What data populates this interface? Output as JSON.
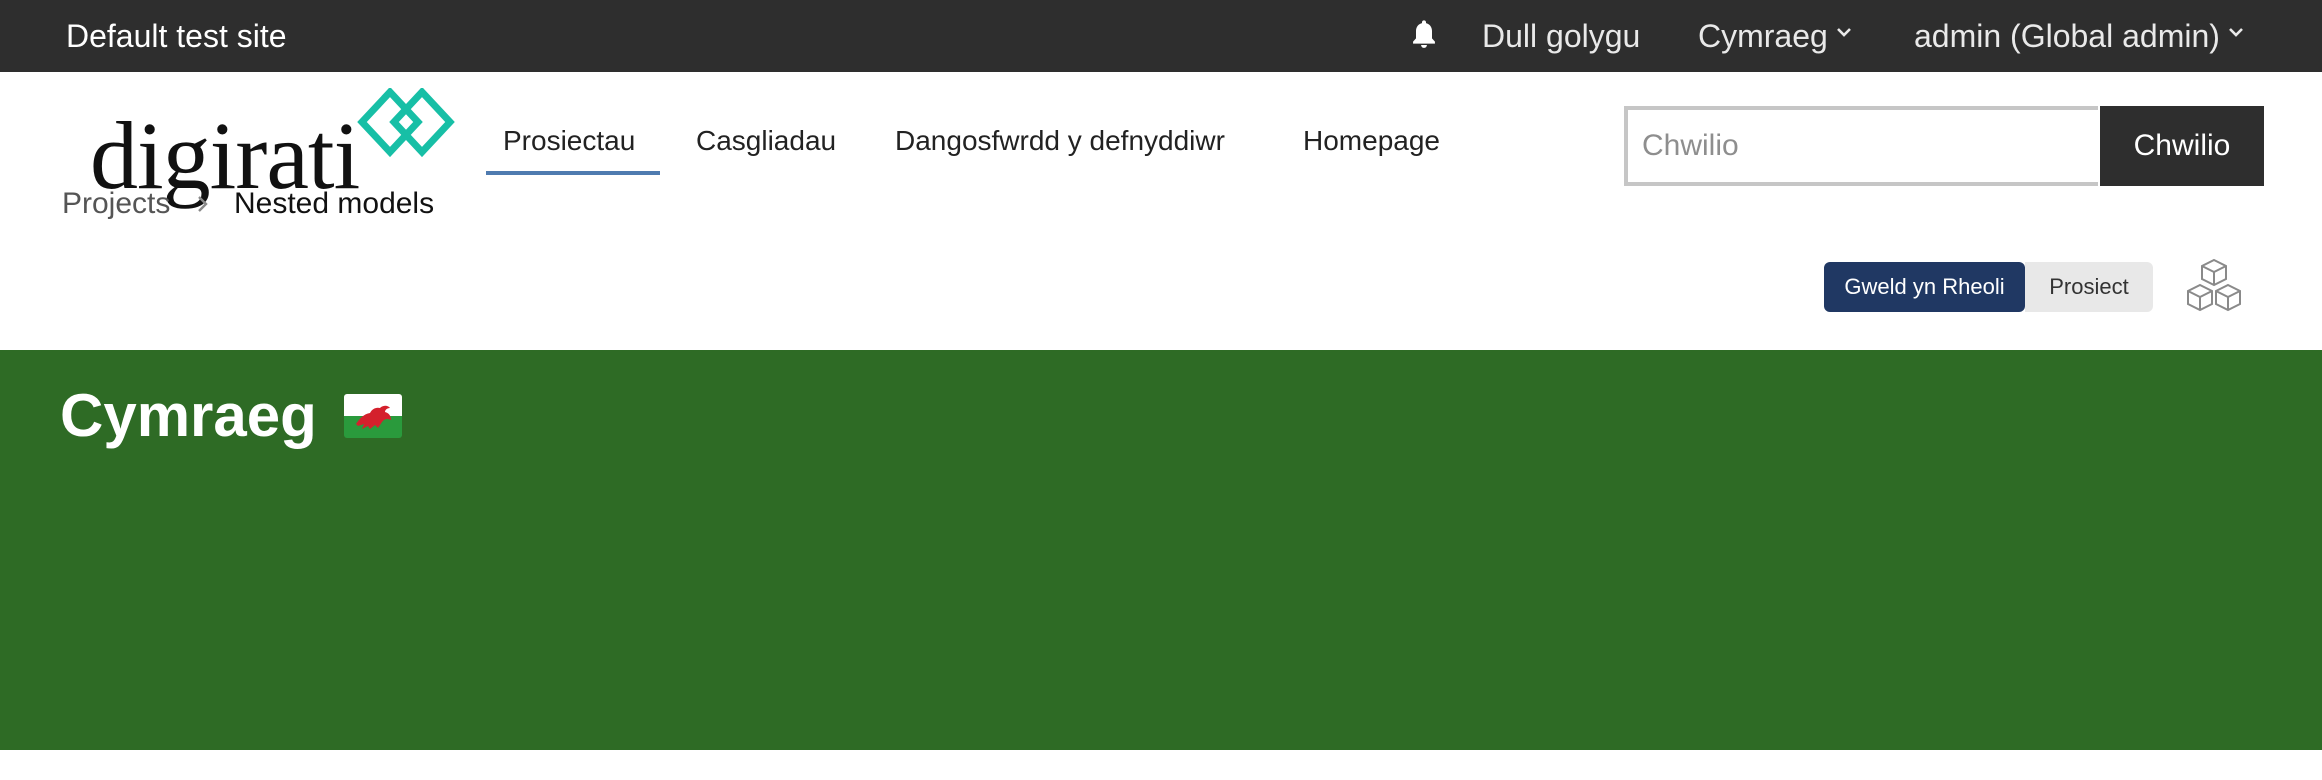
{
  "topbar": {
    "site_name": "Default test site",
    "edit_mode": "Dull golygu",
    "language": "Cymraeg",
    "user": "admin (Global admin)",
    "icons": {
      "notifications": "bell-icon",
      "dropdown": "chevron-down-icon"
    }
  },
  "header": {
    "logo_text": "digirati",
    "nav": [
      "Prosiectau",
      "Casgliadau",
      "Dangosfwrdd y defnyddiwr",
      "Homepage"
    ],
    "active_nav": "Prosiectau",
    "search": {
      "placeholder": "Chwilio",
      "value": "",
      "button": "Chwilio"
    }
  },
  "breadcrumb": [
    "Projects",
    "Nested models"
  ],
  "view_toggle": {
    "active": "Gweld yn Rheoli",
    "inactive": "Prosiect"
  },
  "banner": {
    "title": "Cymraeg",
    "flag_icon": "welsh-flag-icon"
  },
  "colors": {
    "topbar": "#2e2e2e",
    "nav_underline": "#4f7bb0",
    "logo_accent": "#17bfa6",
    "toggle_active": "#203863",
    "banner": "#2e6b25"
  }
}
